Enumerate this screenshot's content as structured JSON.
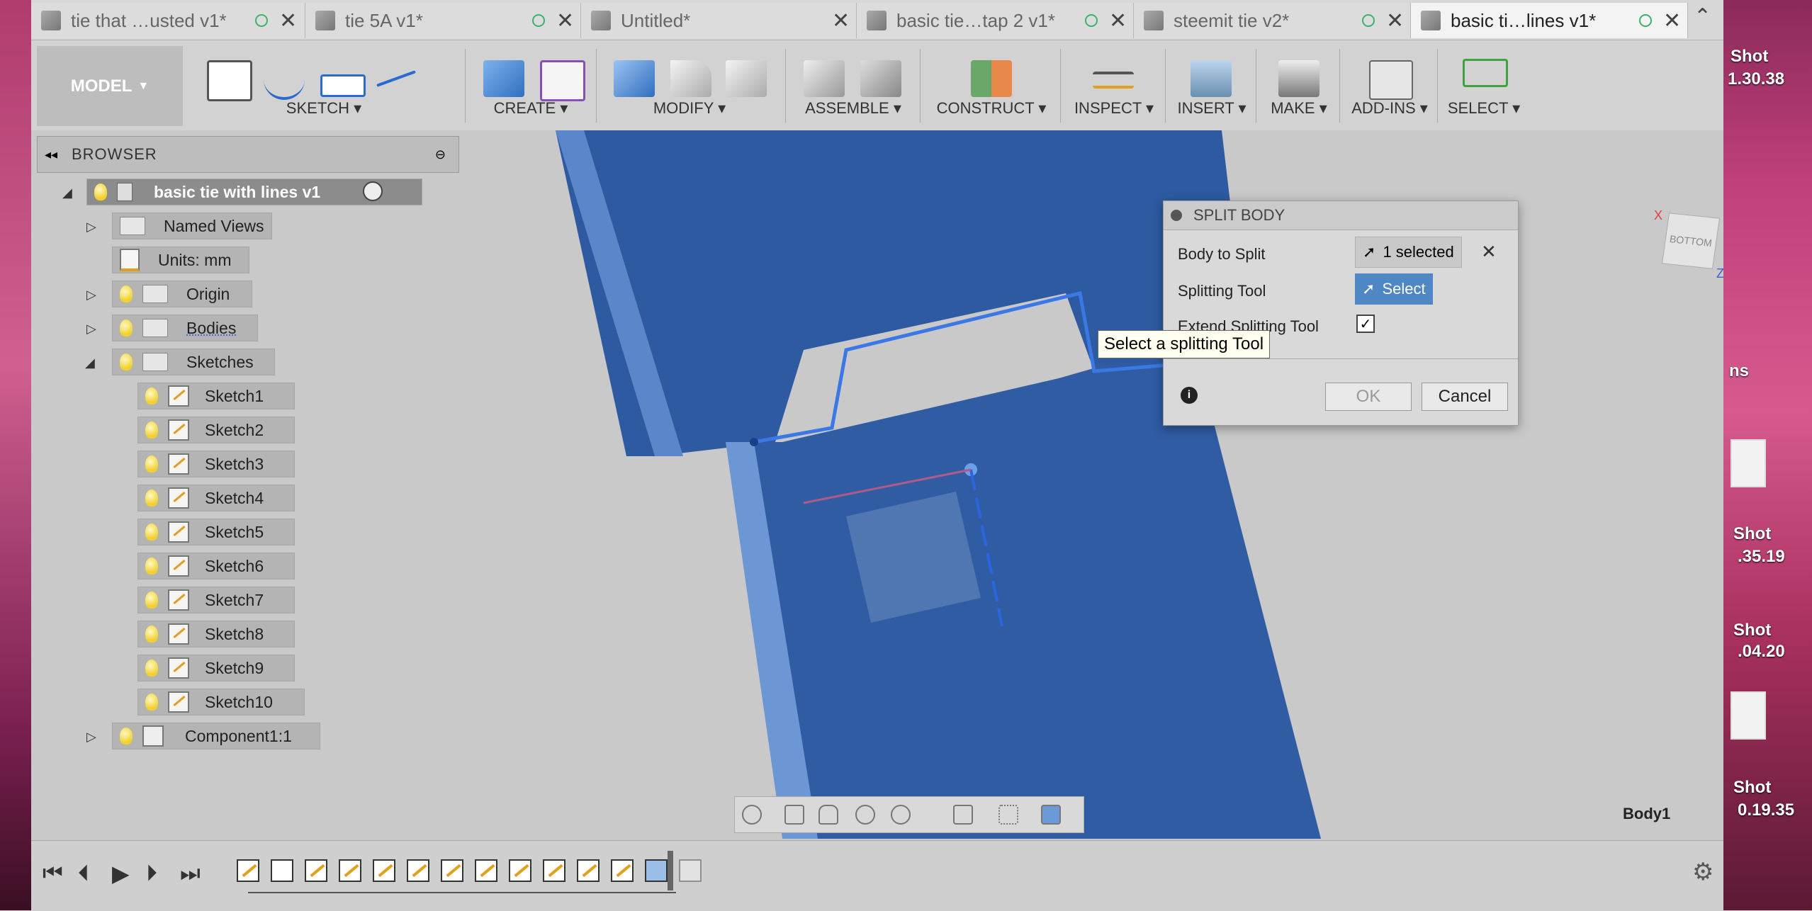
{
  "tabs": [
    {
      "label": "tie that …usted v1*",
      "active": false
    },
    {
      "label": "tie 5A v1*",
      "active": false
    },
    {
      "label": "Untitled*",
      "active": false
    },
    {
      "label": "basic tie…tap 2 v1*",
      "active": false
    },
    {
      "label": "steemit tie v2*",
      "active": false
    },
    {
      "label": "basic ti…lines v1*",
      "active": true
    }
  ],
  "toolbar": {
    "workspace": "MODEL",
    "groups": [
      "SKETCH",
      "CREATE",
      "MODIFY",
      "ASSEMBLE",
      "CONSTRUCT",
      "INSPECT",
      "INSERT",
      "MAKE",
      "ADD-INS",
      "SELECT"
    ]
  },
  "browser": {
    "title": "BROWSER",
    "root": "basic tie with lines v1",
    "named_views": "Named Views",
    "units": "Units: mm",
    "origin": "Origin",
    "bodies": "Bodies",
    "sketches": "Sketches",
    "sketch_items": [
      "Sketch1",
      "Sketch2",
      "Sketch3",
      "Sketch4",
      "Sketch5",
      "Sketch6",
      "Sketch7",
      "Sketch8",
      "Sketch9",
      "Sketch10"
    ],
    "component": "Component1:1"
  },
  "dialog": {
    "title": "SPLIT BODY",
    "body_to_split_label": "Body to Split",
    "body_to_split_value": "1 selected",
    "splitting_tool_label": "Splitting Tool",
    "splitting_tool_value": "Select",
    "extend_label": "Extend Splitting Tool",
    "extend_checked": true,
    "ok": "OK",
    "cancel": "Cancel"
  },
  "tooltip": "Select a splitting Tool",
  "viewcube": {
    "face": "BOTTOM",
    "x_axis": "X",
    "z_axis": "Z"
  },
  "status": {
    "body_label": "Body1"
  },
  "desktop": {
    "labels": [
      "Shot",
      "1.30.38",
      "ns",
      "Shot",
      ".35.19",
      "Shot",
      ".04.20",
      "Shot",
      "0.19.35"
    ]
  },
  "colors": {
    "body_blue": "#2d5aa0",
    "body_edge": "#5b86c9",
    "accent_select": "#4f86c4"
  }
}
